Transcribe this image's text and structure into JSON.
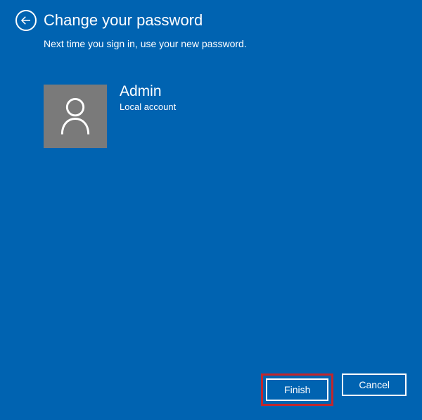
{
  "header": {
    "title": "Change your password",
    "subtitle": "Next time you sign in, use your new password."
  },
  "user": {
    "name": "Admin",
    "type": "Local account"
  },
  "buttons": {
    "finish": "Finish",
    "cancel": "Cancel"
  }
}
